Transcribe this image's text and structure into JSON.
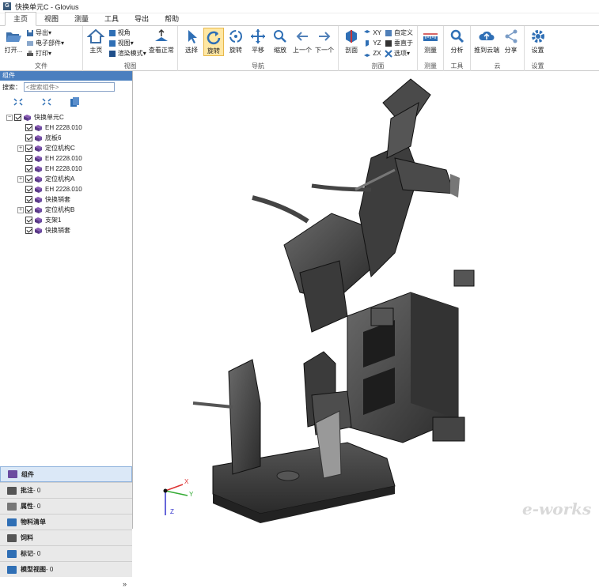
{
  "window": {
    "title": "快换单元C - Glovius",
    "app_icon": "G"
  },
  "menu": {
    "tabs": [
      {
        "label": "主页"
      },
      {
        "label": "视图"
      },
      {
        "label": "测量"
      },
      {
        "label": "工具"
      },
      {
        "label": "导出"
      },
      {
        "label": "帮助"
      }
    ]
  },
  "ribbon": {
    "file": {
      "label": "文件",
      "open": "打开...",
      "export": "导出",
      "ecomp": "电子部件",
      "print": "打印"
    },
    "view": {
      "label": "视图",
      "home": "主页",
      "viewangle": "视角",
      "views": "视图",
      "render": "渲染模式",
      "front": "查看正常"
    },
    "nav": {
      "label": "导航",
      "select": "选择",
      "rotate": "旋转",
      "rotate2": "旋转",
      "pan": "平移",
      "zoom": "缩放",
      "prev": "上一个",
      "next": "下一个"
    },
    "section": {
      "label": "剖面",
      "cut": "剖面",
      "xy": "XY",
      "yz": "YZ",
      "zx": "ZX",
      "custom": "自定义",
      "perp": "垂直于",
      "options": "选项"
    },
    "measure": {
      "label": "测量",
      "measure": "测量"
    },
    "tools": {
      "label": "工具",
      "analyze": "分析"
    },
    "cloud": {
      "label": "云",
      "push": "推到云端",
      "share": "分享"
    },
    "settings": {
      "label": "设置",
      "settings": "设置"
    }
  },
  "panel": {
    "header": "组件",
    "search_label": "搜索：",
    "search_placeholder": "<搜索组件>",
    "tree": [
      {
        "label": "快换单元C",
        "level": 0,
        "expander": "−"
      },
      {
        "label": "EH 2228.010",
        "level": 1,
        "expander": ""
      },
      {
        "label": "底板6",
        "level": 1,
        "expander": ""
      },
      {
        "label": "定位机构C",
        "level": 1,
        "expander": "+"
      },
      {
        "label": "EH 2228.010",
        "level": 1,
        "expander": ""
      },
      {
        "label": "EH 2228.010",
        "level": 1,
        "expander": ""
      },
      {
        "label": "定位机构A",
        "level": 1,
        "expander": "+"
      },
      {
        "label": "EH 2228.010",
        "level": 1,
        "expander": ""
      },
      {
        "label": "快换销套",
        "level": 1,
        "expander": ""
      },
      {
        "label": "定位机构B",
        "level": 1,
        "expander": "+"
      },
      {
        "label": "支架1",
        "level": 1,
        "expander": ""
      },
      {
        "label": "快换销套",
        "level": 1,
        "expander": ""
      }
    ],
    "bottom_tabs": [
      {
        "label": "组件",
        "count": ""
      },
      {
        "label": "批注",
        "count": " - 0"
      },
      {
        "label": "属性",
        "count": " - 0"
      },
      {
        "label": "物料清单",
        "count": ""
      },
      {
        "label": "饲料",
        "count": ""
      },
      {
        "label": "标记",
        "count": " - 0"
      },
      {
        "label": "模型视图",
        "count": " - 0"
      }
    ],
    "collapse": "»"
  },
  "axes": {
    "x": "X",
    "y": "Y",
    "z": "Z"
  },
  "watermark": "e-works",
  "colors": {
    "accent": "#2f6fb5",
    "selected": "#ffe7a3",
    "model": "#3d3d3d",
    "header": "#4a7fbf"
  }
}
